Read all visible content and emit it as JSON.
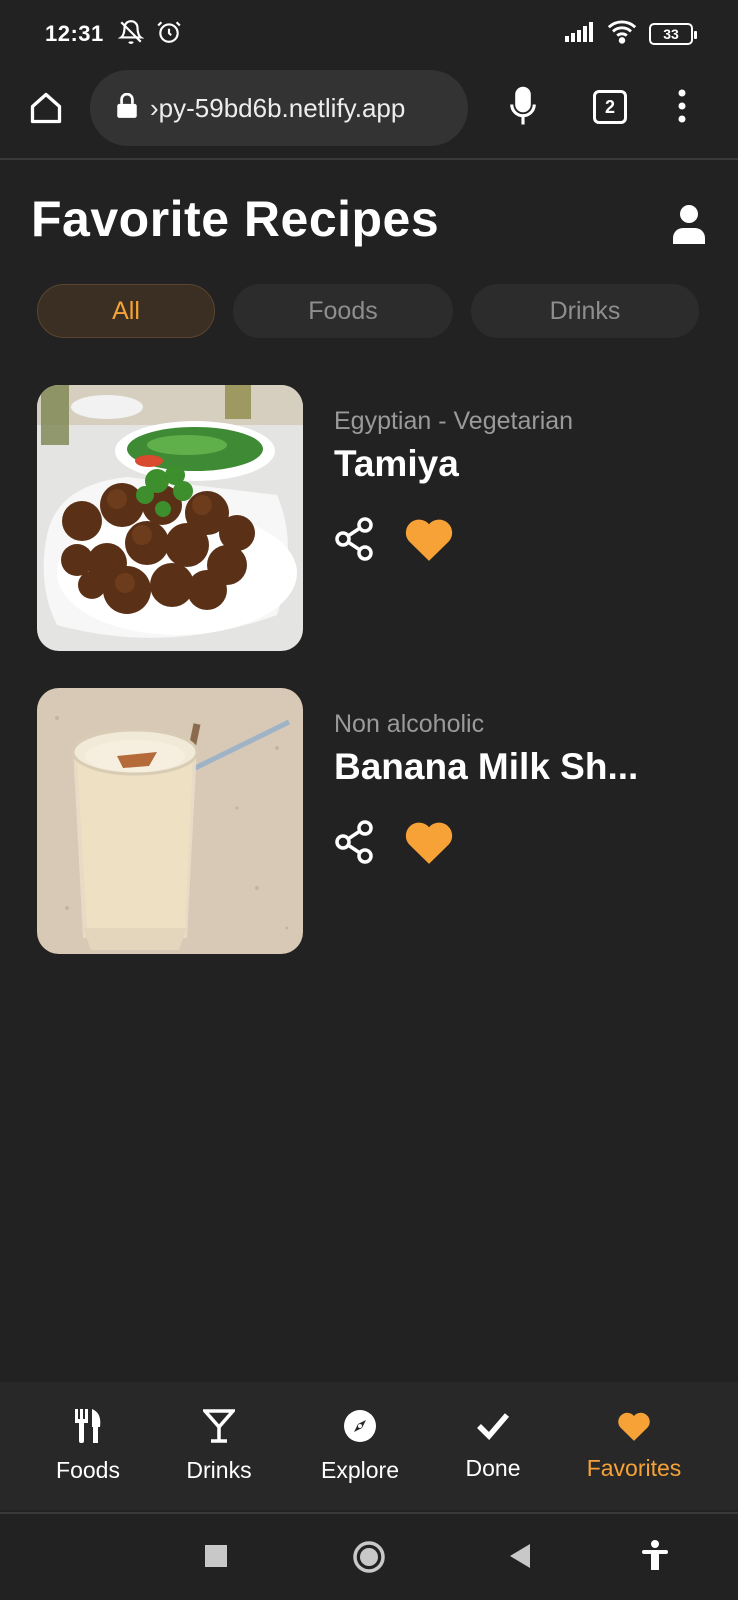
{
  "status_bar": {
    "time": "12:31",
    "battery": "33",
    "icons": [
      "bell-off-icon",
      "alarm-icon",
      "signal-icon",
      "wifi-icon",
      "battery-icon"
    ]
  },
  "browser": {
    "url": "›py-59bd6b.netlify.app",
    "tab_count": "2"
  },
  "header": {
    "title": "Favorite Recipes"
  },
  "filters": [
    {
      "label": "All",
      "active": true
    },
    {
      "label": "Foods",
      "active": false
    },
    {
      "label": "Drinks",
      "active": false
    }
  ],
  "recipes": [
    {
      "subtitle": "Egyptian - Vegetarian",
      "title": "Tamiya",
      "favorite": true
    },
    {
      "subtitle": "Non alcoholic",
      "title": "Banana Milk Sh...",
      "favorite": true
    }
  ],
  "bottom_nav": [
    {
      "label": "Foods",
      "icon": "utensils-icon",
      "active": false
    },
    {
      "label": "Drinks",
      "icon": "cocktail-icon",
      "active": false
    },
    {
      "label": "Explore",
      "icon": "compass-icon",
      "active": false
    },
    {
      "label": "Done",
      "icon": "check-icon",
      "active": false
    },
    {
      "label": "Favorites",
      "icon": "heart-icon",
      "active": true
    }
  ],
  "colors": {
    "accent": "#f6a236",
    "background": "#222222"
  }
}
